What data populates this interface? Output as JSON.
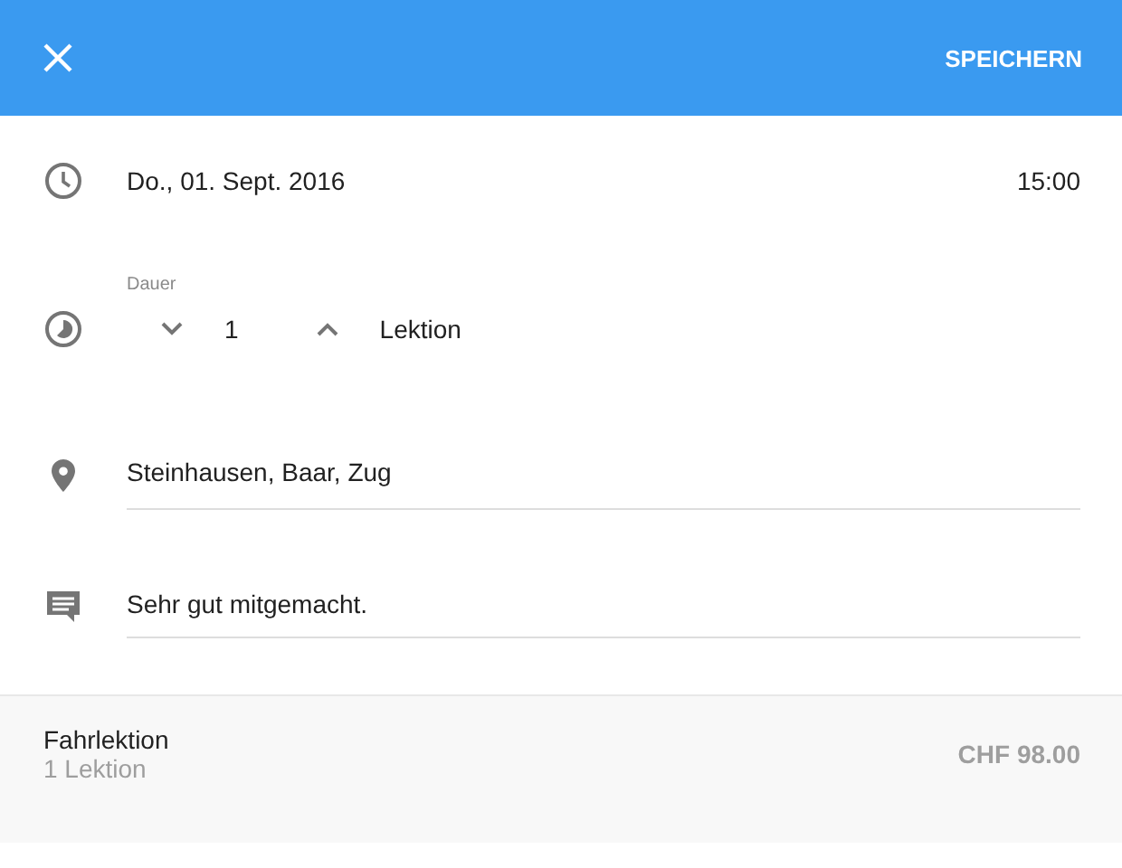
{
  "toolbar": {
    "action": "SPEICHERN"
  },
  "date_row": {
    "date": "Do., 01. Sept. 2016",
    "time": "15:00"
  },
  "duration": {
    "label": "Dauer",
    "value": "1",
    "unit": "Lektion"
  },
  "location": {
    "value": "Steinhausen, Baar, Zug"
  },
  "note": {
    "value": "Sehr gut mitgemacht."
  },
  "summary": {
    "title": "Fahrlektion",
    "subtitle": "1 Lektion",
    "price": "CHF 98.00"
  }
}
